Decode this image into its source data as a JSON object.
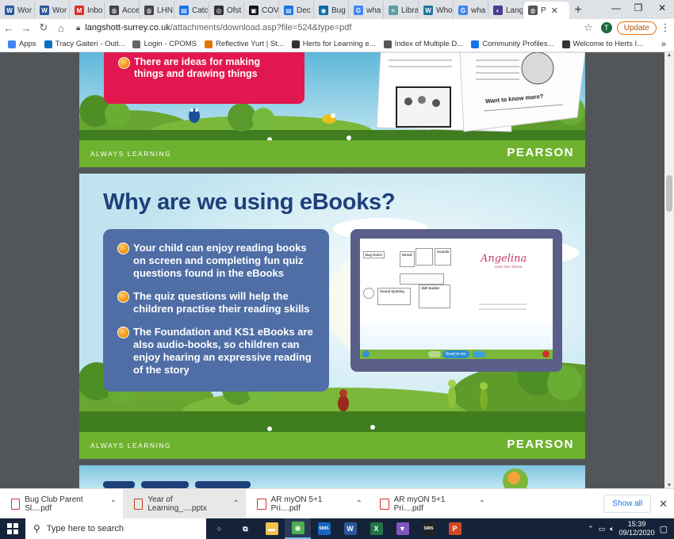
{
  "browser": {
    "tabs": [
      {
        "label": "Wor",
        "color": "#2b579a",
        "glyph": "W"
      },
      {
        "label": "Wor",
        "color": "#2b579a",
        "glyph": "W"
      },
      {
        "label": "Inbo",
        "color": "#d93025",
        "glyph": "M"
      },
      {
        "label": "Acce",
        "color": "#444444",
        "glyph": "◍"
      },
      {
        "label": "LHN",
        "color": "#444444",
        "glyph": "◍"
      },
      {
        "label": "Catc",
        "color": "#1a73e8",
        "glyph": "▤"
      },
      {
        "label": "Ofst",
        "color": "#333333",
        "glyph": "◎"
      },
      {
        "label": "COV",
        "color": "#111111",
        "glyph": "▣"
      },
      {
        "label": "Dec",
        "color": "#1a73e8",
        "glyph": "▤"
      },
      {
        "label": "Bug",
        "color": "#0b6aa2",
        "glyph": "◉"
      },
      {
        "label": "wha",
        "color": "#4285f4",
        "glyph": "G"
      },
      {
        "label": "Libra",
        "color": "#5f9ea0",
        "glyph": "≈"
      },
      {
        "label": "Who",
        "color": "#21759b",
        "glyph": "W"
      },
      {
        "label": "wha",
        "color": "#4285f4",
        "glyph": "G"
      },
      {
        "label": "Lang",
        "color": "#4b3b8f",
        "glyph": "◐"
      }
    ],
    "active_tab": {
      "label": "P",
      "color": "#555555",
      "glyph": "◍"
    },
    "new_tab": "+",
    "window": {
      "minimize": "—",
      "maximize": "❐",
      "close": "✕"
    },
    "url_host": "langshott-surrey.co.uk",
    "url_path": "/attachments/download.asp?file=524&type=pdf",
    "profile_initial": "T",
    "update_label": "Update",
    "bookmarks": [
      {
        "label": "Apps",
        "color": "#4285f4"
      },
      {
        "label": "Tracy Gaiteri - Outl...",
        "color": "#0072c6"
      },
      {
        "label": "Login - CPOMS",
        "color": "#666666"
      },
      {
        "label": "Reflective Yurt | St...",
        "color": "#e37400"
      },
      {
        "label": "Herts for Learning e...",
        "color": "#333333"
      },
      {
        "label": "Index of Multiple D...",
        "color": "#555555"
      },
      {
        "label": "Community Profiles...",
        "color": "#1a73e8"
      },
      {
        "label": "Welcome to Herts I...",
        "color": "#333333"
      }
    ],
    "bookmarks_more": "»"
  },
  "pdf": {
    "slide_top": {
      "bullet": "There are ideas for making things and drawing things",
      "book_text": "Want to know more?",
      "footer_left": "ALWAYS LEARNING",
      "footer_right": "PEARSON"
    },
    "slide_main": {
      "title": "Why are we using eBooks?",
      "bullets": [
        "Your child can enjoy reading books on screen and completing fun quiz questions found in the eBooks",
        "The quiz questions will help the children practise their reading skills",
        "The Foundation and KS1 eBooks are also audio-books, so children can enjoy hearing an expressive reading of the story"
      ],
      "ebook_title": "Angelina",
      "ebook_subtitle": "and the Show",
      "ebook_card1": "Bug Notes",
      "ebook_card2": "Words",
      "ebook_card3": "Sounds",
      "ebook_card4": "Sound Spotting",
      "ebook_card5": "Skill Builder",
      "ebook_read_btn": "Read to me",
      "footer_left": "ALWAYS LEARNING",
      "footer_right": "PEARSON"
    }
  },
  "downloads": {
    "items": [
      {
        "label": "Bug Club Parent Sl....pdf",
        "color": "#d93025"
      },
      {
        "label": "Year of Learning_....pptx",
        "color": "#c43e1c"
      },
      {
        "label": "AR myON 5+1 Pri....pdf",
        "color": "#d93025"
      },
      {
        "label": "AR myON 5+1 Pri....pdf",
        "color": "#d93025"
      }
    ],
    "show_all": "Show all"
  },
  "taskbar": {
    "search_placeholder": "Type here to search",
    "apps": [
      {
        "glyph": "○",
        "color": "transparent"
      },
      {
        "glyph": "⧉",
        "color": "transparent"
      },
      {
        "glyph": "▬",
        "color": "#f2c14e"
      },
      {
        "glyph": "◉",
        "color": "#4caf50"
      },
      {
        "glyph": "SIMS",
        "color": "#1565c0"
      },
      {
        "glyph": "W",
        "color": "#2b579a"
      },
      {
        "glyph": "X",
        "color": "#217346"
      },
      {
        "glyph": "▼",
        "color": "#7e57c2"
      },
      {
        "glyph": "SIMS",
        "color": "#222222"
      },
      {
        "glyph": "P",
        "color": "#d24726"
      }
    ],
    "time": "15:39",
    "date": "09/12/2020"
  }
}
